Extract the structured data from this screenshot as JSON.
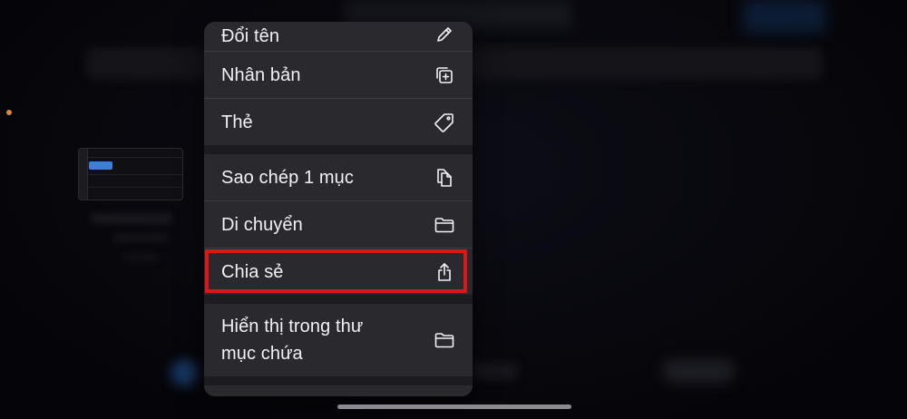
{
  "menu": {
    "items": [
      {
        "label": "Đổi tên",
        "icon": "pencil-icon"
      },
      {
        "label": "Nhân bản",
        "icon": "duplicate-icon"
      },
      {
        "label": "Thẻ",
        "icon": "tag-icon"
      },
      {
        "label": "Sao chép 1 mục",
        "icon": "copy-doc-icon"
      },
      {
        "label": "Di chuyển",
        "icon": "folder-icon"
      },
      {
        "label": "Chia sẻ",
        "icon": "share-icon"
      },
      {
        "label_line1": "Hiển thị trong thư",
        "label_line2": "mục chứa",
        "icon": "folder-icon"
      }
    ]
  },
  "colors": {
    "menu_bg": "#2a2a2e",
    "text": "#f2f2f6",
    "highlight": "#e01414",
    "thumb_clip": "#3a7fd8",
    "accent_dot": "#d8893c"
  }
}
